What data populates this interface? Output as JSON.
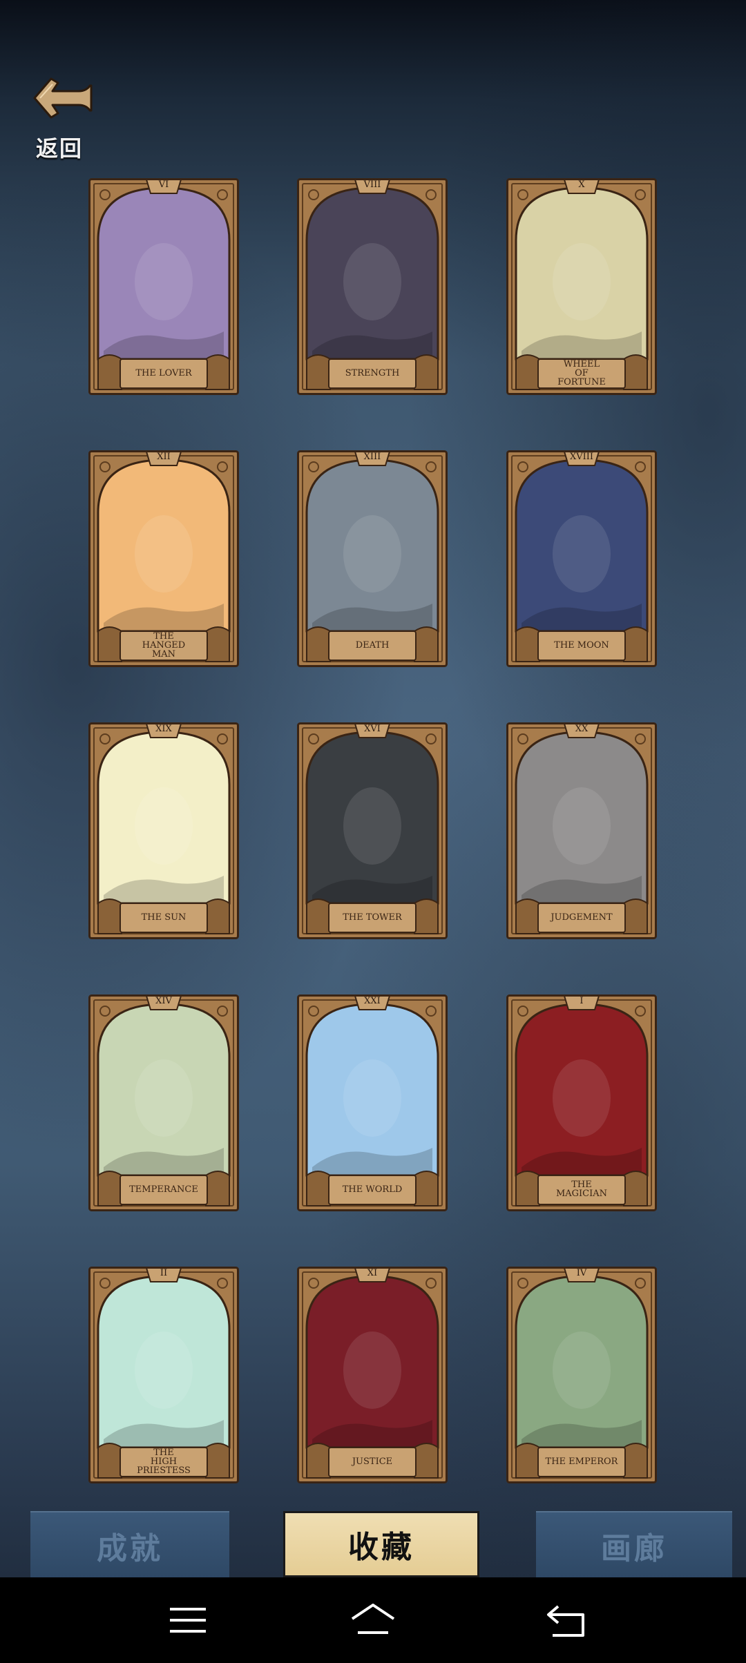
{
  "header": {
    "back_label": "返回"
  },
  "cards": [
    {
      "title": "THE LOVER",
      "numeral": "VI"
    },
    {
      "title": "STRENGTH",
      "numeral": "VIII"
    },
    {
      "title": "WHEEL\nOF\nFORTUNE",
      "numeral": "X"
    },
    {
      "title": "THE\nHANGED\nMAN",
      "numeral": "XII"
    },
    {
      "title": "DEATH",
      "numeral": "XIII"
    },
    {
      "title": "THE MOON",
      "numeral": "XVIII"
    },
    {
      "title": "THE SUN",
      "numeral": "XIX"
    },
    {
      "title": "THE TOWER",
      "numeral": "XVI"
    },
    {
      "title": "JUDGEMENT",
      "numeral": "XX"
    },
    {
      "title": "TEMPERANCE",
      "numeral": "XIV"
    },
    {
      "title": "THE WORLD",
      "numeral": "XXI"
    },
    {
      "title": "THE\nMAGICIAN",
      "numeral": "I"
    },
    {
      "title": "THE\nHIGH\nPRIESTESS",
      "numeral": "II"
    },
    {
      "title": "JUSTICE",
      "numeral": "XI"
    },
    {
      "title": "THE EMPEROR",
      "numeral": "IV"
    }
  ],
  "card_art_colors": [
    "#9a86b8",
    "#4a4458",
    "#d9d2a6",
    "#f2b978",
    "#7c8894",
    "#3c4a78",
    "#f3efc8",
    "#3a3e42",
    "#8c8a8a",
    "#c8d6b4",
    "#9ec8ea",
    "#8c1e22",
    "#bfe6d8",
    "#7a1e28",
    "#8aa882"
  ],
  "tabs": {
    "achievements": "成就",
    "collection": "收藏",
    "gallery": "画廊"
  },
  "colors": {
    "card_frame": "#a87c4c",
    "card_border": "#3a2414",
    "tab_active": "#e8d39e",
    "tab_inactive": "#34506f"
  },
  "navbar": {
    "menu_icon": "menu-icon",
    "home_icon": "home-icon",
    "back_icon": "back-icon"
  }
}
